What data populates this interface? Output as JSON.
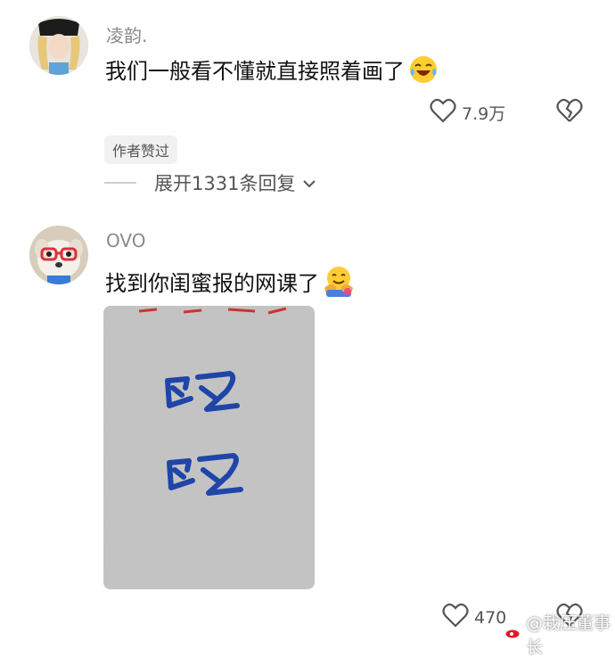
{
  "comment1": {
    "username": "凌韵.",
    "text": "我们一般看不懂就直接照着画了",
    "emoji": "laughing-crying-emoji",
    "likes": "7.9万",
    "badge": "作者赞过",
    "expand_replies": "展开1331条回复"
  },
  "comment2": {
    "username": "OVO",
    "text": "找到你闺蜜报的网课了",
    "emoji": "hugging-face-emoji",
    "likes": "470",
    "watermark": "@栽压董事长"
  },
  "colors": {
    "username": "#8a8a8a",
    "text": "#111111",
    "ink": "#1a3c9a",
    "badge_bg": "#f1f1f1"
  }
}
